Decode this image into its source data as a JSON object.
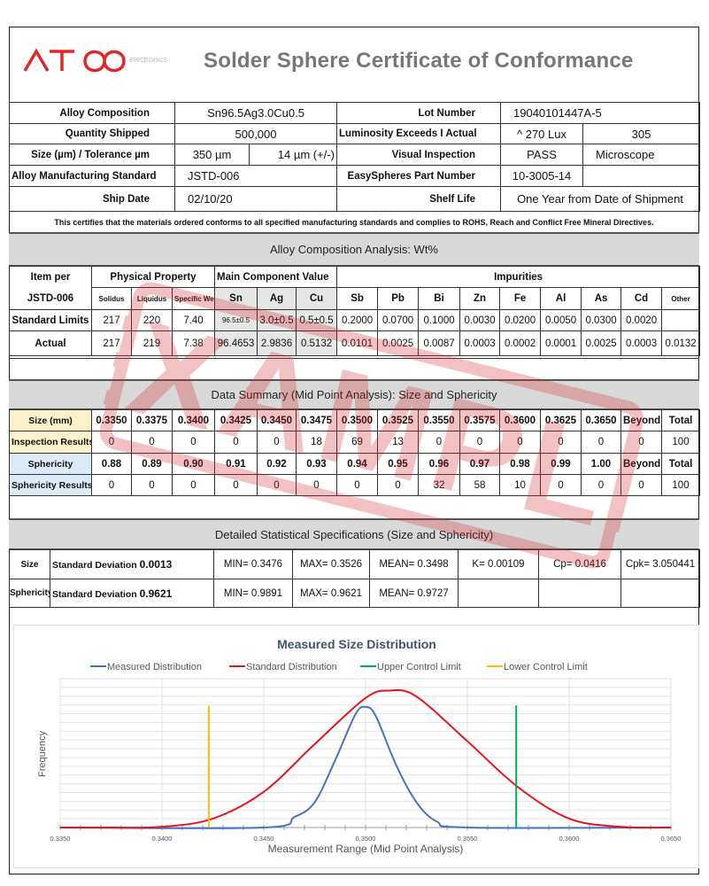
{
  "header": {
    "logo_text": "ATOO",
    "logo_sub": "electronics",
    "title": "Solder Sphere Certificate of Conformance"
  },
  "info": {
    "alloy_composition_label": "Alloy Composition",
    "alloy_composition": "Sn96.5Ag3.0Cu0.5",
    "lot_number_label": "Lot Number",
    "lot_number": "19040101447A-5",
    "quantity_label": "Quantity Shipped",
    "quantity": "500,000",
    "luminosity_label": "Luminosity Exceeds I Actual",
    "luminosity_exceeds": "^ 270 Lux",
    "luminosity_actual": "305",
    "size_label": "Size (µm) / Tolerance µm",
    "size": "350 µm",
    "tolerance": "14 µm (+/-)",
    "visual_label": "Visual Inspection",
    "visual_result": "PASS",
    "visual_method": "Microscope",
    "standard_label": "Alloy Manufacturing Standard",
    "standard": "JSTD-006",
    "part_label": "EasySpheres Part Number",
    "part_number": "10-3005-14",
    "ship_date_label": "Ship Date",
    "ship_date": "02/10/20",
    "shelf_label": "Shelf Life",
    "shelf_life": "One Year from Date of Shipment"
  },
  "certification": "This certifies that the materials ordered conforms to all specified manufacturing standards and complies to ROHS, Reach and Conflict Free Mineral Directives.",
  "composition": {
    "title": "Alloy Composition Analysis: Wt%",
    "item_label_1": "Item per",
    "item_label_2": "JSTD-006",
    "group_physical": "Physical Property",
    "group_main": "Main Component Value",
    "group_impurities": "Impurities",
    "columns": [
      "Solidus",
      "Liquidus",
      "Specific Weight",
      "Sn",
      "Ag",
      "Cu",
      "Sb",
      "Pb",
      "Bi",
      "Zn",
      "Fe",
      "Al",
      "As",
      "Cd",
      "Other"
    ],
    "rows": [
      {
        "label": "Standard Limits",
        "values": [
          "217",
          "220",
          "7.40",
          "96.5±0.5",
          "3.0±0.5",
          "0.5±0.5",
          "0.2000",
          "0.0700",
          "0.1000",
          "0.0030",
          "0.0200",
          "0.0050",
          "0.0300",
          "0.0020",
          ""
        ]
      },
      {
        "label": "Actual",
        "values": [
          "217",
          "219",
          "7.38",
          "96.4653",
          "2.9836",
          "0.5132",
          "0.0101",
          "0.0025",
          "0.0087",
          "0.0003",
          "0.0002",
          "0.0001",
          "0.0025",
          "0.0003",
          "0.0132"
        ]
      }
    ]
  },
  "summary": {
    "title": "Data Summary (Mid Point Analysis): Size and Sphericity",
    "rows": [
      {
        "label": "Size (mm)",
        "values": [
          "0.3350",
          "0.3375",
          "0.3400",
          "0.3425",
          "0.3450",
          "0.3475",
          "0.3500",
          "0.3525",
          "0.3550",
          "0.3575",
          "0.3600",
          "0.3625",
          "0.3650",
          "Beyond",
          "Total"
        ]
      },
      {
        "label": "Inspection Results",
        "values": [
          "0",
          "0",
          "0",
          "0",
          "0",
          "18",
          "69",
          "13",
          "0",
          "0",
          "0",
          "0",
          "0",
          "0",
          "100"
        ]
      },
      {
        "label": "Sphericity",
        "values": [
          "0.88",
          "0.89",
          "0.90",
          "0.91",
          "0.92",
          "0.93",
          "0.94",
          "0.95",
          "0.96",
          "0.97",
          "0.98",
          "0.99",
          "1.00",
          "Beyond",
          "Total"
        ]
      },
      {
        "label": "Sphericity Results",
        "values": [
          "0",
          "0",
          "0",
          "0",
          "0",
          "0",
          "0",
          "0",
          "32",
          "58",
          "10",
          "0",
          "0",
          "0",
          "100"
        ]
      }
    ]
  },
  "statistics": {
    "title": "Detailed Statistical Specifications (Size and Sphericity)",
    "rows": [
      {
        "label": "Size",
        "sd_label": "Standard Deviation",
        "sd": "0.0013",
        "min": "MIN= 0.3476",
        "max": "MAX=  0.3526",
        "mean": "MEAN=  0.3498",
        "k": "K= 0.00109",
        "cp": "Cp= 0.0416",
        "cpk": "Cpk= 3.050441"
      },
      {
        "label": "Sphericity",
        "sd_label": "Standard Deviation",
        "sd": "0.9621",
        "min": "MIN= 0.9891",
        "max": "MAX=  0.9621",
        "mean": "MEAN=  0.9727",
        "k": "",
        "cp": "",
        "cpk": ""
      }
    ]
  },
  "watermark": "EXAMPLE",
  "chart_data": {
    "type": "line",
    "title": "Measured Size Distribution",
    "xlabel": "Measurement Range (Mid Point Analysis)",
    "ylabel": "Frequency",
    "xlim": [
      0.335,
      0.365
    ],
    "ylim": [
      0,
      1
    ],
    "x_ticks": [
      "0.3350",
      "0.3400",
      "0.3450",
      "0.3500",
      "0.3550",
      "0.3600",
      "0.3650"
    ],
    "grid": "horizontal and vertical",
    "legend_position": "top",
    "series": [
      {
        "name": "Measured Distribution",
        "color": "#4472c4",
        "x": [
          0.335,
          0.345,
          0.3465,
          0.3475,
          0.3485,
          0.3495,
          0.35,
          0.3505,
          0.3515,
          0.3525,
          0.3535,
          0.355,
          0.365
        ],
        "y": [
          0,
          0,
          0.07,
          0.17,
          0.45,
          0.76,
          0.81,
          0.75,
          0.42,
          0.17,
          0.04,
          0,
          0
        ]
      },
      {
        "name": "Standard Distribution",
        "color": "#e8141b",
        "x": [
          0.335,
          0.3375,
          0.34,
          0.3425,
          0.345,
          0.3475,
          0.35,
          0.3512,
          0.3525,
          0.355,
          0.3575,
          0.36,
          0.3625,
          0.365
        ],
        "y": [
          0,
          0,
          0.005,
          0.06,
          0.24,
          0.56,
          0.87,
          0.92,
          0.88,
          0.58,
          0.27,
          0.06,
          0.005,
          0
        ]
      },
      {
        "name": "Upper Control Limit",
        "color": "#00b050",
        "x": [
          0.3574,
          0.3574
        ],
        "y": [
          0,
          0.82
        ]
      },
      {
        "name": "Lower Control Limit",
        "color": "#ffc000",
        "x": [
          0.3423,
          0.3423
        ],
        "y": [
          0,
          0.82
        ]
      }
    ]
  }
}
